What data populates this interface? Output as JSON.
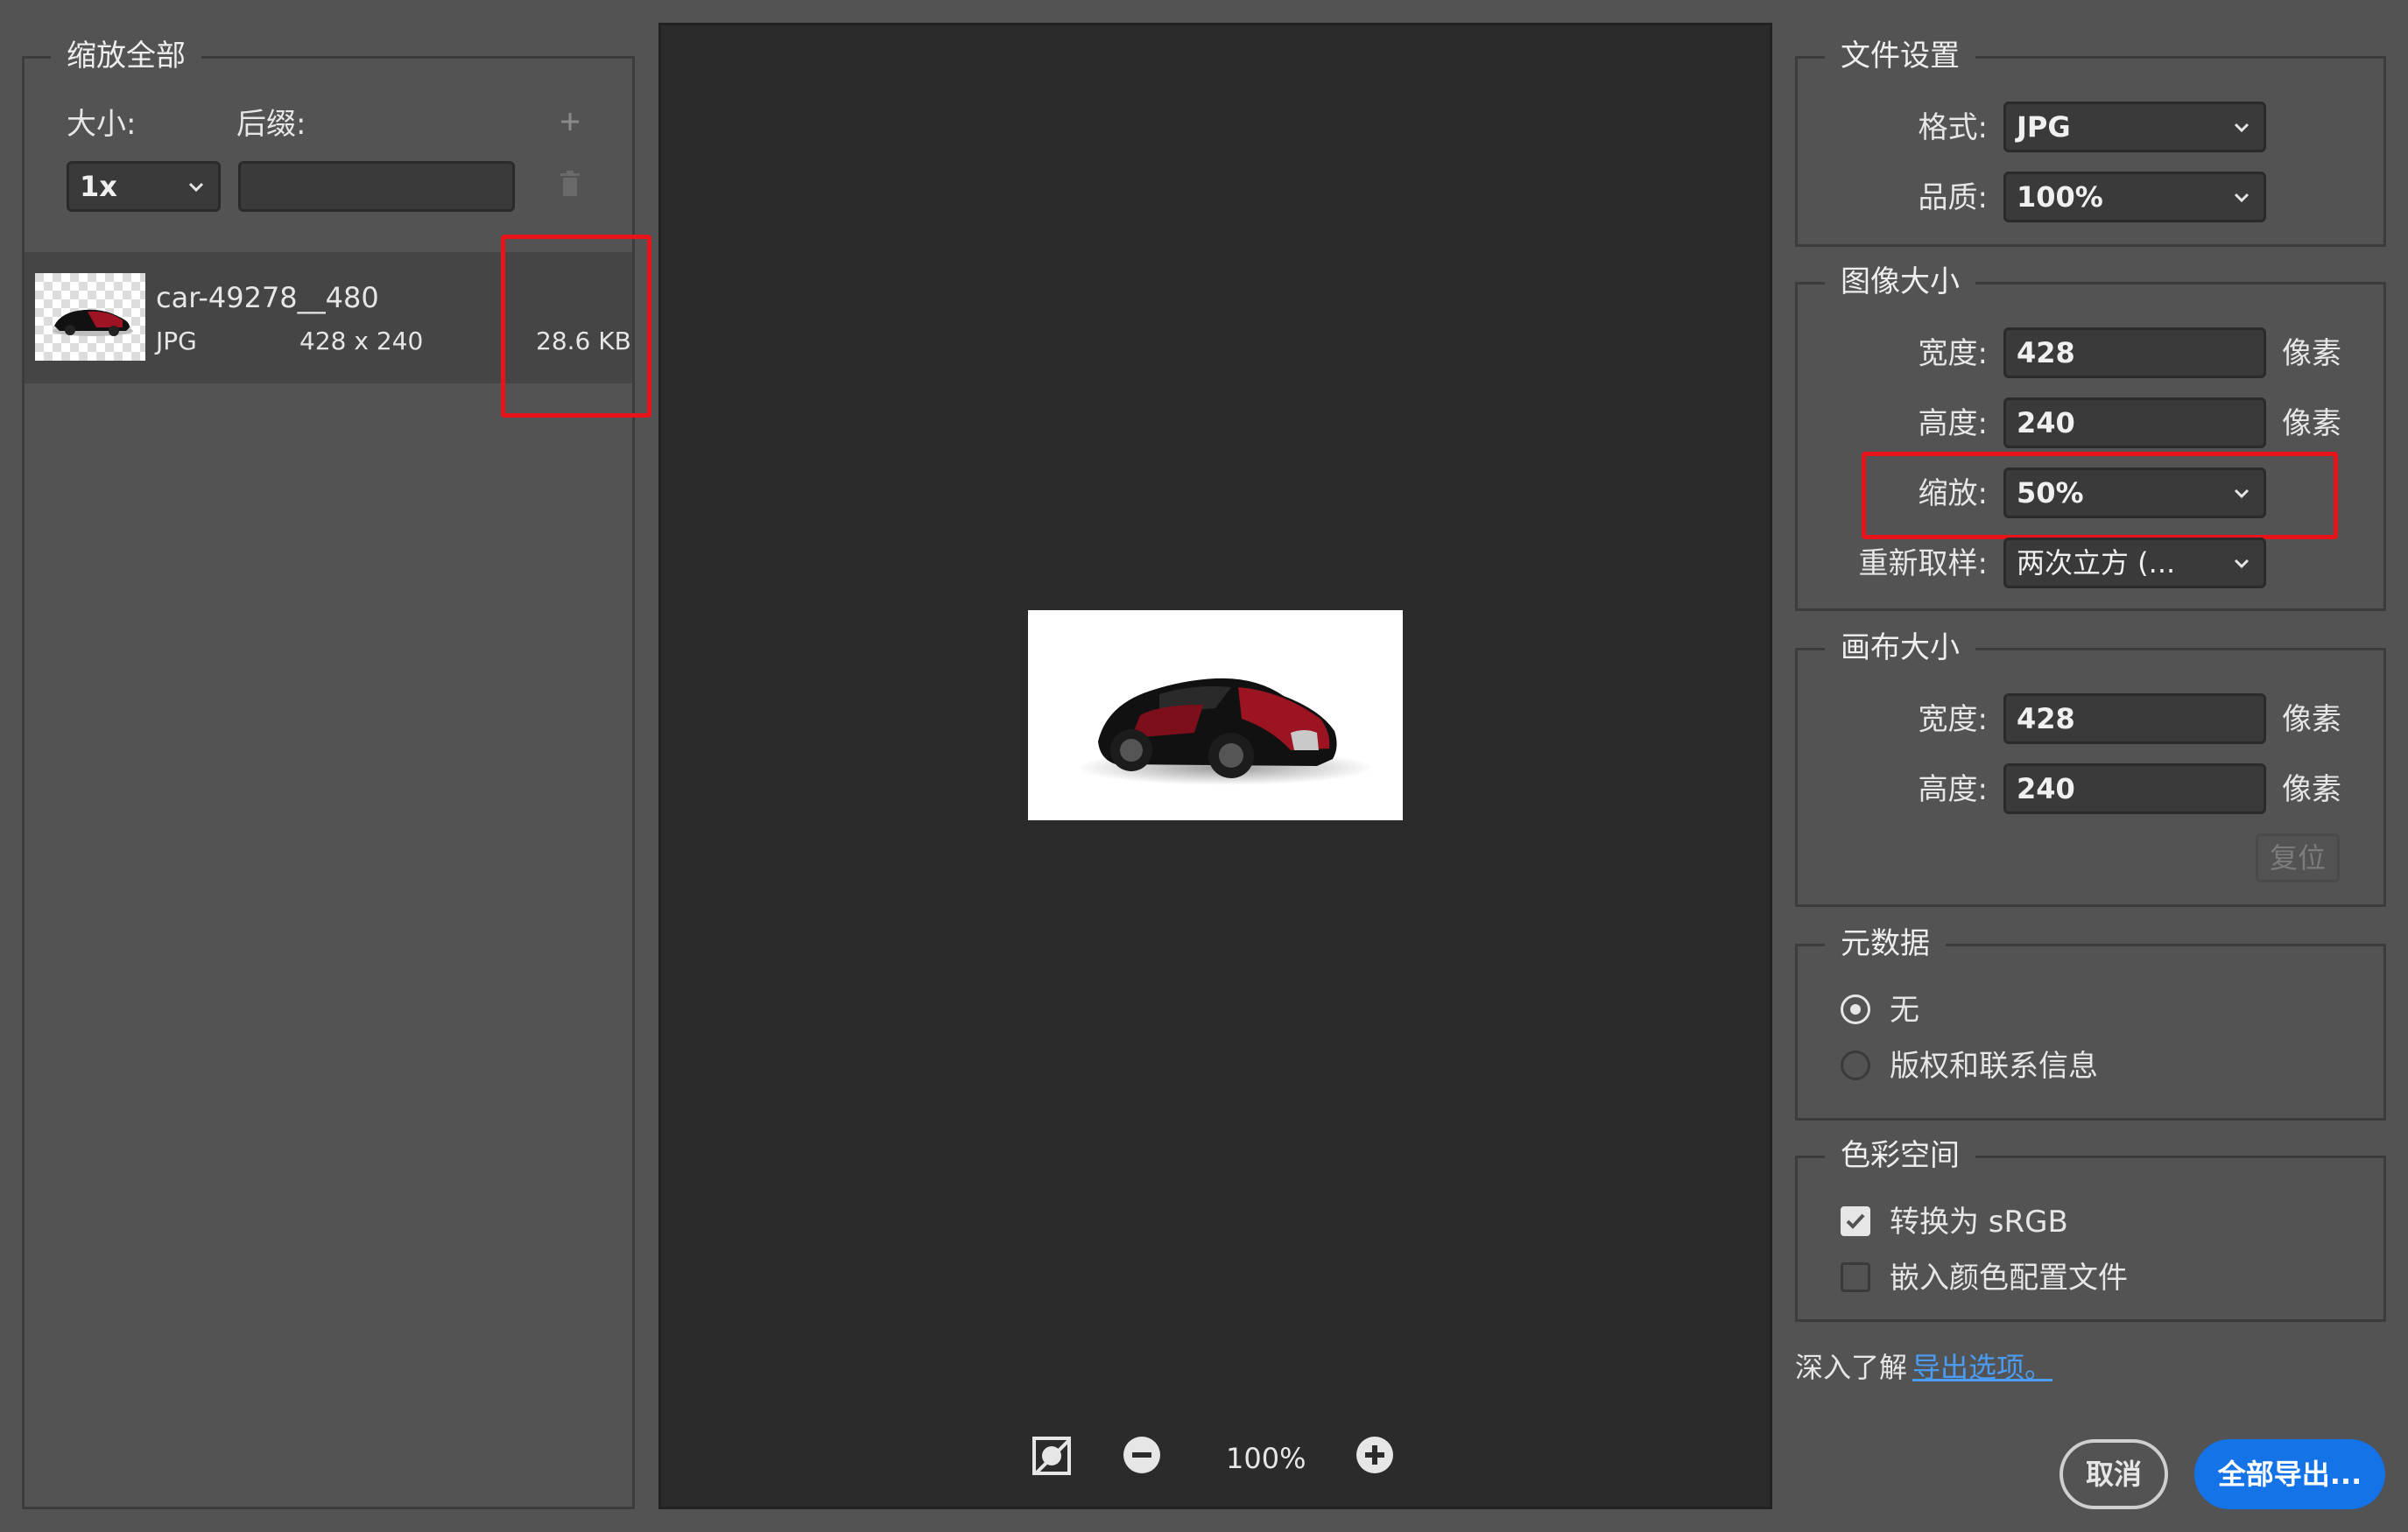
{
  "left": {
    "title": "缩放全部",
    "size_label": "大小:",
    "suffix_label": "后缀:",
    "size_value": "1x",
    "suffix_value": "",
    "add_icon": "plus-icon",
    "delete_icon": "trash-icon",
    "file": {
      "name": "car-49278__480",
      "format": "JPG",
      "dimensions": "428 x 240",
      "size": "28.6 KB"
    }
  },
  "preview": {
    "zoom": "100%",
    "icons": [
      "toggle-background-icon",
      "zoom-out-icon",
      "zoom-in-icon"
    ]
  },
  "file_settings": {
    "title": "文件设置",
    "format_label": "格式:",
    "format_value": "JPG",
    "quality_label": "品质:",
    "quality_value": "100%"
  },
  "image_size": {
    "title": "图像大小",
    "width_label": "宽度:",
    "width_value": "428",
    "height_label": "高度:",
    "height_value": "240",
    "unit": "像素",
    "scale_label": "缩放:",
    "scale_value": "50%",
    "resample_label": "重新取样:",
    "resample_value": "两次立方 (..."
  },
  "canvas_size": {
    "title": "画布大小",
    "width_label": "宽度:",
    "width_value": "428",
    "height_label": "高度:",
    "height_value": "240",
    "unit": "像素",
    "reset_label": "复位"
  },
  "metadata": {
    "title": "元数据",
    "option_none": "无",
    "option_copyright": "版权和联系信息",
    "selected": "无"
  },
  "color_space": {
    "title": "色彩空间",
    "convert_srgb": "转换为 sRGB",
    "convert_srgb_checked": true,
    "embed_profile": "嵌入颜色配置文件",
    "embed_profile_checked": false
  },
  "footer": {
    "learn_more": "深入了解",
    "link_text": "导出选项。",
    "cancel_label": "取消",
    "export_label": "全部导出...",
    "accent_color": "#1473e6",
    "link_color": "#4b9cf5"
  }
}
